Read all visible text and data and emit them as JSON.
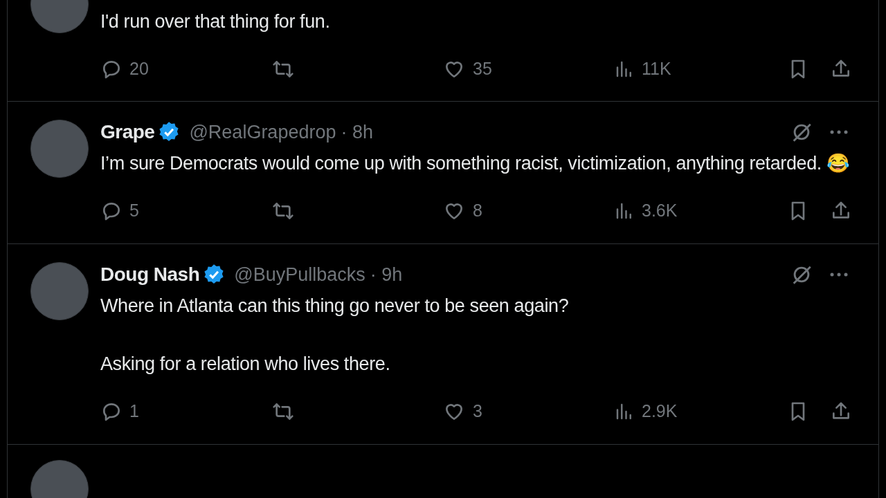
{
  "tweets": [
    {
      "text": "I'd run over that thing for fun.",
      "replies": "20",
      "likes": "35",
      "views": "11K"
    },
    {
      "name": "Grape",
      "verified": true,
      "handle": "@RealGrapedrop",
      "time": "· 8h",
      "text": "I’m sure Democrats would come up with something racist, victimization, anything retarded. 😂",
      "replies": "5",
      "likes": "8",
      "views": "3.6K"
    },
    {
      "name": "Doug Nash",
      "verified": true,
      "handle": "@BuyPullbacks",
      "time": "· 9h",
      "text": "Where in Atlanta can this thing go never to be seen again?\n\nAsking for a relation who lives there.",
      "replies": "1",
      "likes": "3",
      "views": "2.9K"
    }
  ]
}
